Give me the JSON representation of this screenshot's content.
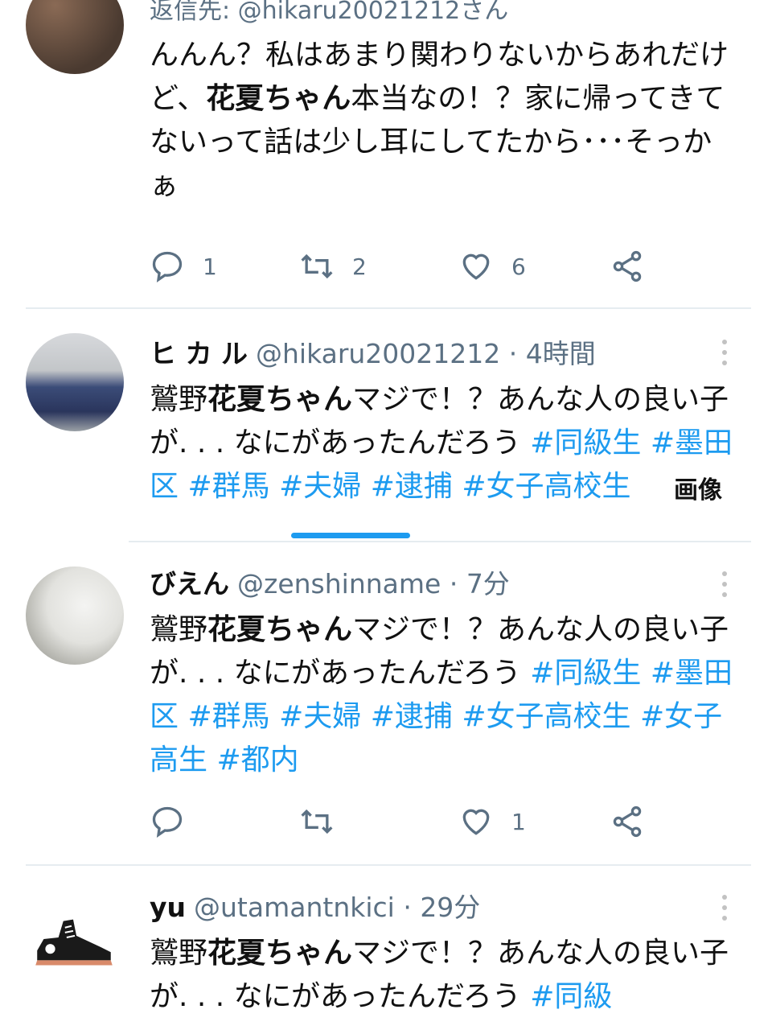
{
  "tweets": [
    {
      "reply_to": "返信先: @hikaru20021212さん",
      "text_a": "んんん？私はあまり関わりないからあれだけど、",
      "text_bold": "花夏ちゃん",
      "text_b": "本当なの！？家に帰ってきてないって話は少し耳にしてたから･･･そっかぁ",
      "replies": "1",
      "retweets": "2",
      "likes": "6"
    },
    {
      "name": "ヒ カ ル",
      "handle": "@hikaru20021212",
      "time": "4時間",
      "text_a": "鷲野",
      "text_bold": "花夏ちゃん",
      "text_b": "マジで！？あんな人の良い子が. . . なにがあったんだろう ",
      "tags": [
        "#同級生",
        "#墨田区",
        "#群馬",
        "#夫婦",
        "#逮捕",
        "#女子高校生"
      ],
      "image_label": "画像"
    },
    {
      "name": "びえん",
      "handle": "@zenshinname",
      "time": "7分",
      "text_a": "鷲野",
      "text_bold": "花夏ちゃん",
      "text_b": "マジで！？あんな人の良い子が. . . なにがあったんだろう ",
      "tags": [
        "#同級生",
        "#墨田区",
        "#群馬",
        "#夫婦",
        "#逮捕",
        "#女子高校生",
        "#女子高生",
        "#都内"
      ],
      "replies": "",
      "retweets": "",
      "likes": "1"
    },
    {
      "name": "yu",
      "handle": "@utamantnkici",
      "time": "29分",
      "text_a": "鷲野",
      "text_bold": "花夏ちゃん",
      "text_b": "マジで！？あんな人の良い子が. . . なにがあったんだろう ",
      "tags": [
        "#同級"
      ]
    }
  ],
  "separator": " · ",
  "colors": {
    "link": "#1d9bf0",
    "muted": "#5b7083",
    "scroll_indicator": "#1d9bf0"
  },
  "icons": [
    "reply-icon",
    "retweet-icon",
    "like-icon",
    "share-icon",
    "more-icon"
  ]
}
